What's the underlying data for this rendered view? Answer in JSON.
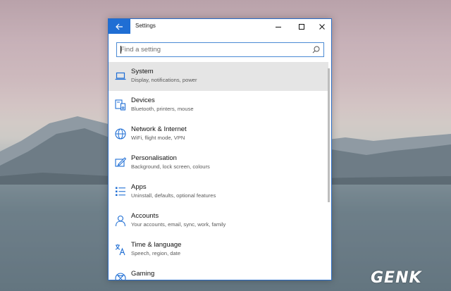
{
  "window": {
    "title": "Settings",
    "controls": {
      "minimize": "minimize-icon",
      "maximize": "maximize-icon",
      "close": "close-icon"
    }
  },
  "search": {
    "placeholder": "Find a setting"
  },
  "categories": [
    {
      "name": "System",
      "desc": "Display, notifications, power",
      "icon": "laptop-icon",
      "selected": true
    },
    {
      "name": "Devices",
      "desc": "Bluetooth, printers, mouse",
      "icon": "devices-icon"
    },
    {
      "name": "Network & Internet",
      "desc": "WiFi, flight mode, VPN",
      "icon": "globe-icon"
    },
    {
      "name": "Personalisation",
      "desc": "Background, lock screen, colours",
      "icon": "paint-icon"
    },
    {
      "name": "Apps",
      "desc": "Uninstall, defaults, optional features",
      "icon": "apps-list-icon"
    },
    {
      "name": "Accounts",
      "desc": "Your accounts, email, sync, work, family",
      "icon": "person-icon"
    },
    {
      "name": "Time & language",
      "desc": "Speech, region, date",
      "icon": "time-language-icon"
    },
    {
      "name": "Gaming",
      "desc": "",
      "icon": "xbox-icon"
    }
  ],
  "watermark": "GENK",
  "colors": {
    "accent": "#1f6ed4",
    "selected_bg": "#e5e5e5",
    "icon": "#1f6ed4"
  }
}
